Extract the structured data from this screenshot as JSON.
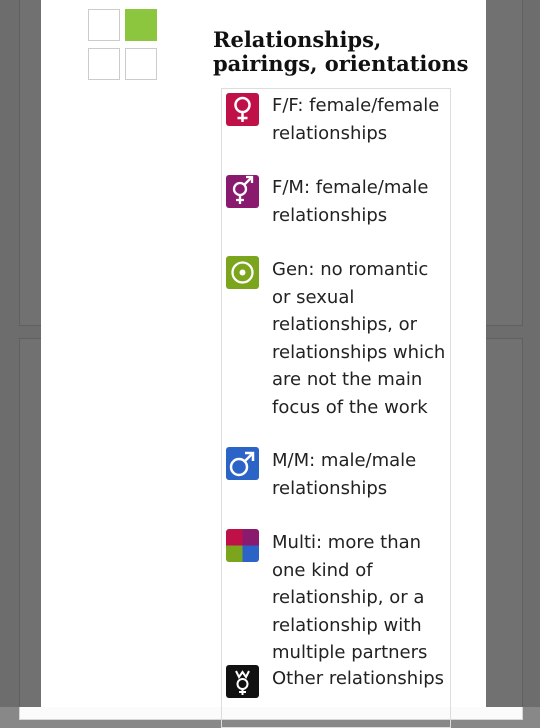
{
  "modal": {
    "title": "Relationships, pairings, orientations"
  },
  "relationships": [
    {
      "icon": "female-female-icon",
      "label": "F/F: female/female relationships",
      "color": "#c01048"
    },
    {
      "icon": "female-male-icon",
      "label": "F/M: female/male relationships",
      "color": "#8a1a6e"
    },
    {
      "icon": "gen-icon",
      "label": "Gen: no romantic or sexual relationships, or relationships which are not the main focus of the work",
      "color": "#7aa51c"
    },
    {
      "icon": "male-male-icon",
      "label": "M/M: male/male relationships",
      "color": "#2b63c6"
    },
    {
      "icon": "multi-icon",
      "label": "Multi: more than one kind of relationship, or a relationship with multiple partners",
      "color": "#8a1a6e"
    },
    {
      "icon": "other-icon",
      "label": "Other relationships",
      "color": "#111111"
    }
  ]
}
